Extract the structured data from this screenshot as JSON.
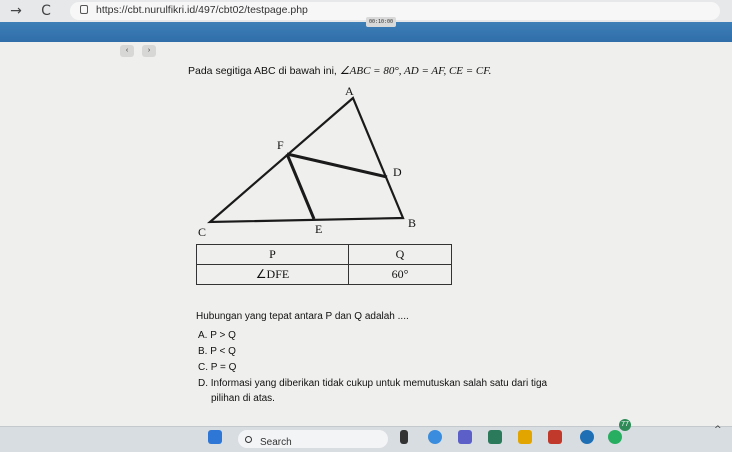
{
  "browser": {
    "url": "https://cbt.nurulfikri.id/497/cbt02/testpage.php",
    "back_icon": "→",
    "reload_icon": "C"
  },
  "exam": {
    "timer": "00:10:00",
    "prev_label": "‹",
    "next_label": "›"
  },
  "question": {
    "intro": "Pada segitiga ABC di bawah ini,",
    "condition": "∠ABC = 80°, AD = AF, CE = CF.",
    "figure_labels": {
      "a": "A",
      "b": "B",
      "c": "C",
      "d": "D",
      "e": "E",
      "f": "F"
    },
    "table": {
      "header_p": "P",
      "header_q": "Q",
      "value_p": "∠DFE",
      "value_q": "60°"
    },
    "prompt": "Hubungan yang tepat antara P dan Q adalah ....",
    "options": [
      {
        "label": "A.",
        "text": "P > Q"
      },
      {
        "label": "B.",
        "text": "P < Q"
      },
      {
        "label": "C.",
        "text": "P = Q"
      },
      {
        "label": "D.",
        "text": "Informasi yang diberikan tidak cukup untuk memutuskan salah satu dari tiga"
      }
    ],
    "option_d_cont": "pilihan di atas."
  },
  "taskbar": {
    "search_label": "Search",
    "badge": "77",
    "chevron": "^"
  },
  "colors": {
    "accent_bar": "#2f6ea9",
    "background": "#efefed"
  }
}
